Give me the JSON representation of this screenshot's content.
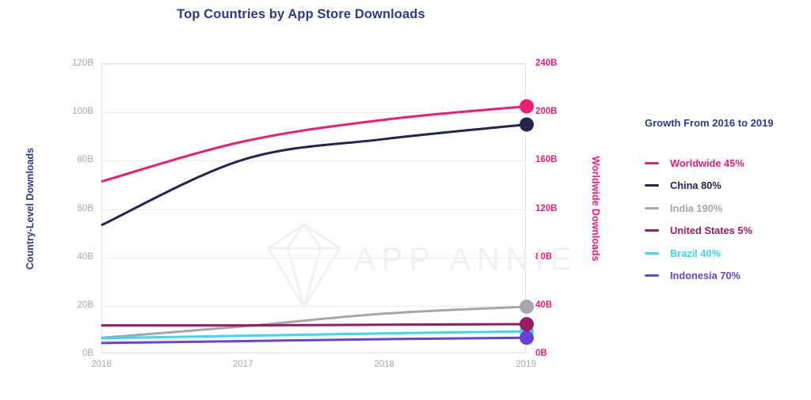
{
  "header": {
    "title": "Top Countries by App Store Downloads"
  },
  "watermark": {
    "text": "APP ANNIE",
    "logo_icon": "diamond-gem-icon"
  },
  "legend": {
    "title": "Growth From 2016 to 2019",
    "items": [
      {
        "label": "Worldwide 45%",
        "color": "#ec1e74"
      },
      {
        "label": "China 80%",
        "color": "#232450"
      },
      {
        "label": "India 190%",
        "color": "#a6a6ac"
      },
      {
        "label": "United States 5%",
        "color": "#991b63"
      },
      {
        "label": "Brazil 40%",
        "color": "#3ad7f0"
      },
      {
        "label": "Indonesia 70%",
        "color": "#6a42d6"
      }
    ]
  },
  "chart_data": {
    "type": "line",
    "title": "Top Countries by App Store Downloads",
    "xlabel": "",
    "ylabel": "Country-Level Downloads",
    "y2label": "Worldwide Downloads",
    "categories": [
      "2016",
      "2017",
      "2018",
      "2019"
    ],
    "x": [
      2016,
      2017,
      2018,
      2019
    ],
    "ylim": [
      0,
      120
    ],
    "y2lim": [
      0,
      240
    ],
    "yticks": [
      "0B",
      "20B",
      "40B",
      "60B",
      "80B",
      "100B",
      "120B"
    ],
    "ytick_values": [
      0,
      20,
      40,
      60,
      80,
      100,
      120
    ],
    "y2ticks": [
      "0B",
      "40B",
      "80B",
      "120B",
      "160B",
      "200B",
      "240B"
    ],
    "y2tick_values": [
      0,
      40,
      80,
      120,
      160,
      200,
      240
    ],
    "grid": true,
    "legend_position": "right",
    "units": "billions of downloads",
    "series": [
      {
        "name": "Worldwide",
        "axis": "right",
        "color": "#ec1e74",
        "growth": "45%",
        "values": [
          143,
          176,
          194,
          205
        ],
        "endpoint_marker": true
      },
      {
        "name": "China",
        "axis": "left",
        "color": "#232450",
        "growth": "80%",
        "values": [
          53.5,
          80.5,
          89,
          95
        ],
        "endpoint_marker": true
      },
      {
        "name": "India",
        "axis": "left",
        "color": "#a6a6ac",
        "growth": "190%",
        "values": [
          6.8,
          11.5,
          16.8,
          19.6
        ],
        "endpoint_marker": true
      },
      {
        "name": "United States",
        "axis": "left",
        "color": "#991b63",
        "growth": "5%",
        "values": [
          11.9,
          11.9,
          12.2,
          12.4
        ],
        "endpoint_marker": true
      },
      {
        "name": "Brazil",
        "axis": "left",
        "color": "#3ad7f0",
        "growth": "40%",
        "values": [
          6.6,
          7.6,
          8.6,
          9.4
        ],
        "endpoint_marker": true
      },
      {
        "name": "Indonesia",
        "axis": "left",
        "color": "#6a42d6",
        "growth": "70%",
        "values": [
          4.6,
          5.4,
          6.2,
          6.8
        ],
        "endpoint_marker": true
      }
    ]
  },
  "colors": {
    "title": "#2b3a8f",
    "left_axis": "#2b3a8f",
    "right_axis": "#ec1e74",
    "tick": "#a9a9ad",
    "grid": "#ececee",
    "watermark": "#f0f0f2"
  }
}
